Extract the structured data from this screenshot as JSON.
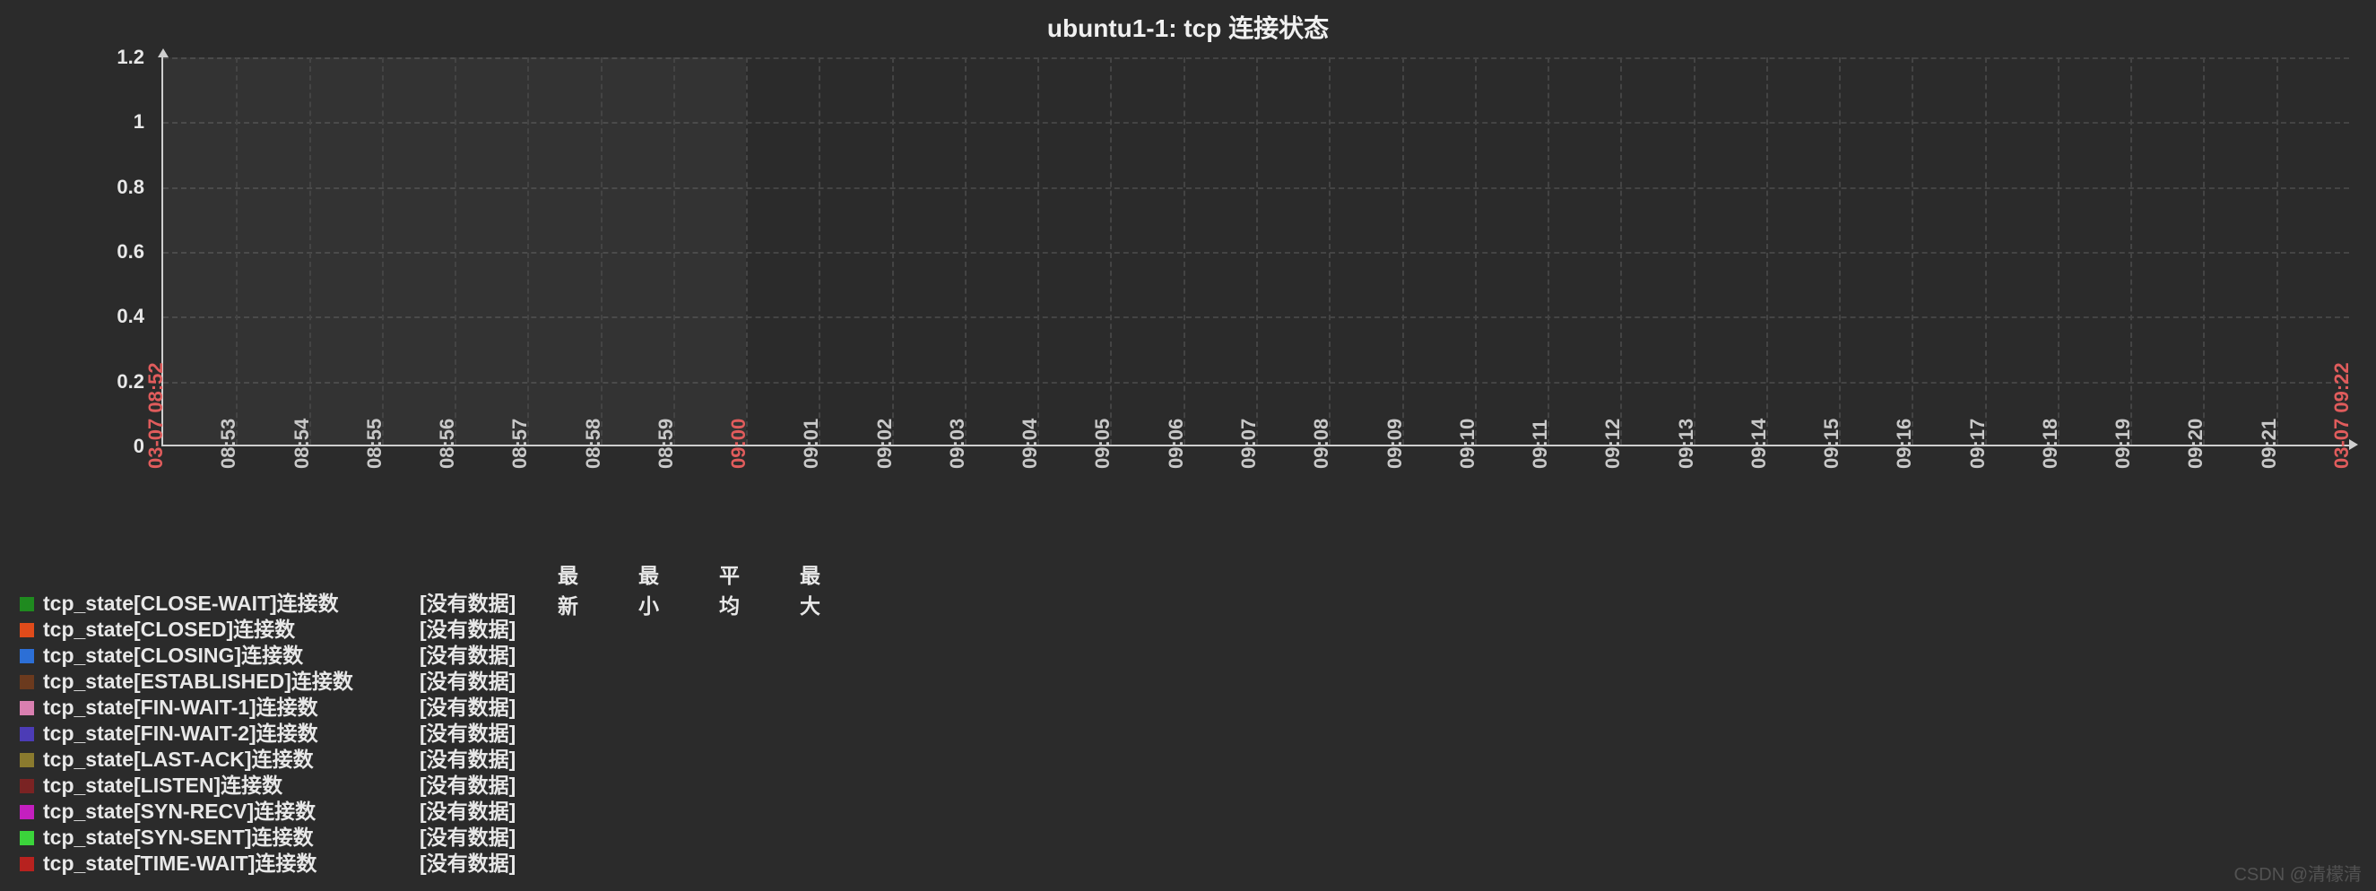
{
  "chart_data": {
    "type": "line",
    "title": "ubuntu1-1: tcp 连接状态",
    "ylabel": "",
    "xlabel": "",
    "ylim": [
      0,
      1.2
    ],
    "y_ticks": [
      0,
      0.2,
      0.4,
      0.6,
      0.8,
      1.0,
      1.2
    ],
    "x_categories": [
      "03-07 08:52",
      "08:53",
      "08:54",
      "08:55",
      "08:56",
      "08:57",
      "08:58",
      "08:59",
      "09:00",
      "09:01",
      "09:02",
      "09:03",
      "09:04",
      "09:05",
      "09:06",
      "09:07",
      "09:08",
      "09:09",
      "09:10",
      "09:11",
      "09:12",
      "09:13",
      "09:14",
      "09:15",
      "09:16",
      "09:17",
      "09:18",
      "09:19",
      "09:20",
      "09:21",
      "03-07 09:22"
    ],
    "x_endpoints": [
      "03-07 08:52",
      "09:00",
      "03-07 09:22"
    ],
    "selection_band": {
      "from": "03-07 08:52",
      "to": "09:00"
    },
    "series": [
      {
        "name": "tcp_state[CLOSE-WAIT]连接数",
        "color": "#1f8a1f",
        "values": null
      },
      {
        "name": "tcp_state[CLOSED]连接数",
        "color": "#e04b1a",
        "values": null
      },
      {
        "name": "tcp_state[CLOSING]连接数",
        "color": "#2c6fd6",
        "values": null
      },
      {
        "name": "tcp_state[ESTABLISHED]连接数",
        "color": "#6b3a1e",
        "values": null
      },
      {
        "name": "tcp_state[FIN-WAIT-1]连接数",
        "color": "#d97fb0",
        "values": null
      },
      {
        "name": "tcp_state[FIN-WAIT-2]连接数",
        "color": "#4c3cb6",
        "values": null
      },
      {
        "name": "tcp_state[LAST-ACK]连接数",
        "color": "#8a7a2e",
        "values": null
      },
      {
        "name": "tcp_state[LISTEN]连接数",
        "color": "#7a2323",
        "values": null
      },
      {
        "name": "tcp_state[SYN-RECV]连接数",
        "color": "#c41fbf",
        "values": null
      },
      {
        "name": "tcp_state[SYN-SENT]连接数",
        "color": "#3bd43b",
        "values": null
      },
      {
        "name": "tcp_state[TIME-WAIT]连接数",
        "color": "#b7221f",
        "values": null
      }
    ],
    "legend_columns": [
      "最新",
      "最小",
      "平均",
      "最大"
    ],
    "no_data_label": "[没有数据]"
  },
  "watermark": "CSDN @清檬清"
}
